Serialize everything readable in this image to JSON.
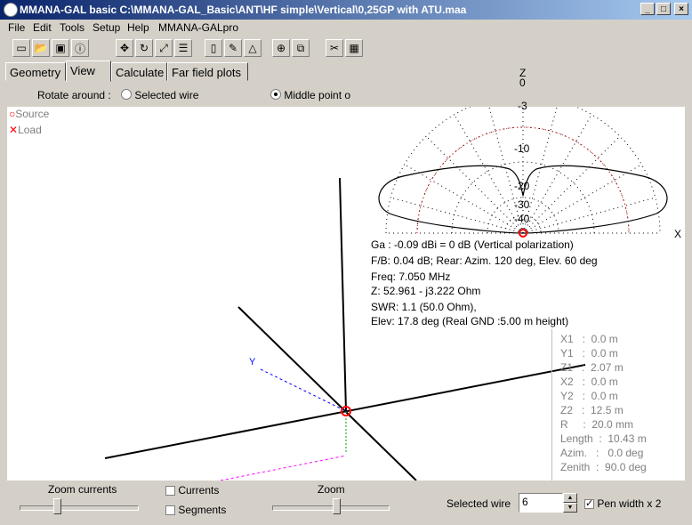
{
  "window": {
    "title": "MMANA-GAL basic C:\\MMANA-GAL_Basic\\ANT\\HF simple\\Vertical\\0,25GP with ATU.maa"
  },
  "menu": [
    "File",
    "Edit",
    "Tools",
    "Setup",
    "Help",
    "MMANA-GALpro"
  ],
  "toolbar_icons": [
    "new-icon",
    "open-icon",
    "save-icon",
    "info-icon",
    "move-icon",
    "rotate-icon",
    "scale-icon",
    "align-icon",
    "page-icon",
    "pen-icon",
    "triangle-icon",
    "target-icon",
    "copy-icon",
    "tools-icon",
    "calculator-icon"
  ],
  "tabs": [
    "Geometry",
    "View",
    "Calculate",
    "Far field plots"
  ],
  "active_tab": "View",
  "rotate": {
    "label": "Rotate around :",
    "opt1": "Selected wire",
    "opt2": "Middle point o"
  },
  "legend": {
    "source": "Source",
    "load": "Load"
  },
  "polar": {
    "z_label": "Z",
    "x_label": "X",
    "ring_labels": [
      "0",
      "-3",
      "-10",
      "-20",
      "-30",
      "-40"
    ]
  },
  "results": {
    "ga": "Ga : -0.09 dBi = 0 dB  (Vertical polarization)",
    "fb": "F/B: 0.04 dB; Rear: Azim. 120 deg,  Elev. 60 deg",
    "freq": "Freq: 7.050 MHz",
    "z": "Z: 52.961 - j3.222 Ohm",
    "swr": "SWR: 1.1 (50.0 Ohm),",
    "elev": "Elev: 17.8 deg (Real GND  :5.00 m height)"
  },
  "wire": {
    "x1": "X1   :  0.0 m",
    "y1": "Y1   :  0.0 m",
    "z1": "Z1   :  2.07 m",
    "x2": "X2   :  0.0 m",
    "y2": "Y2   :  0.0 m",
    "z2": "Z2   :  12.5 m",
    "r": "R     :  20.0 mm",
    "length": "Length  :  10.43 m",
    "azim": "Azim.   :   0.0 deg",
    "zenith": "Zenith  :  90.0 deg"
  },
  "axis_y": "Y",
  "bottom": {
    "zoom_currents": "Zoom currents",
    "currents": "Currents",
    "segments": "Segments",
    "zoom": "Zoom",
    "selected_wire_label": "Selected wire",
    "selected_wire_value": "6",
    "pen_width": "Pen width x 2"
  },
  "colors": {
    "title_start": "#0a246a",
    "title_end": "#a6caf0",
    "source": "#ff0000",
    "grid_red": "#ff0000",
    "y_axis": "#0000ff"
  }
}
